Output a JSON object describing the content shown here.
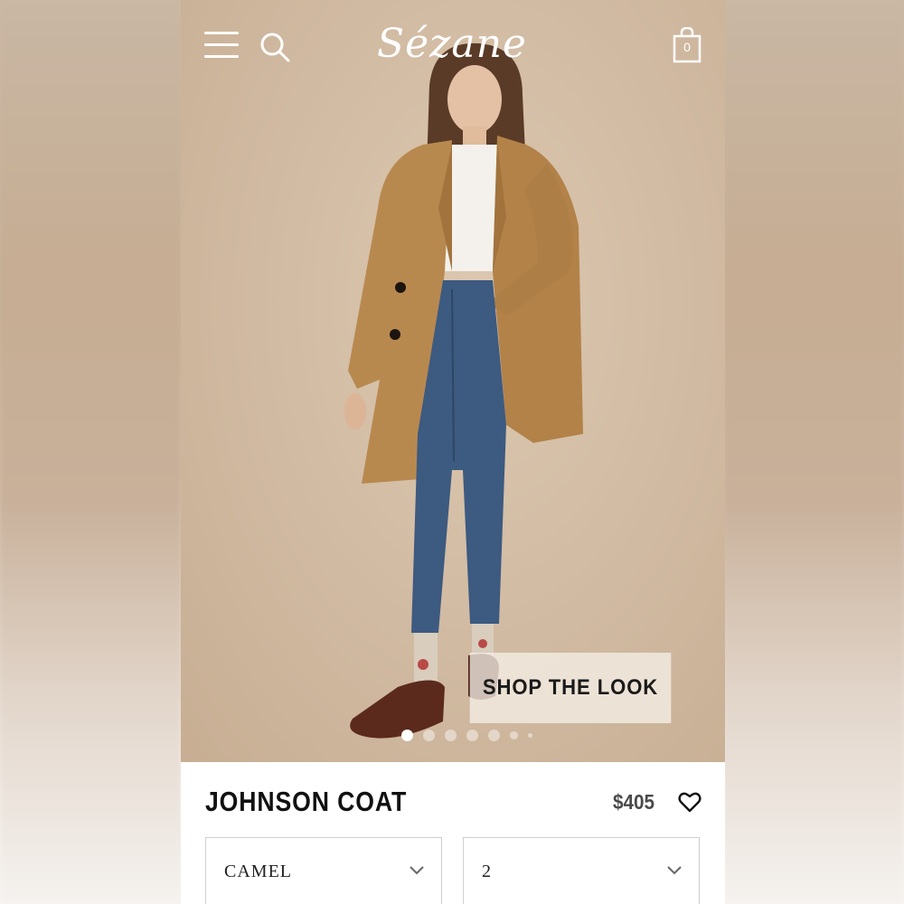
{
  "header": {
    "brand": "Sézane",
    "cart_count": "0"
  },
  "hero": {
    "shop_the_look_label": "SHOP THE LOOK",
    "carousel_dots": 7,
    "active_dot": 1
  },
  "product": {
    "name": "JOHNSON COAT",
    "price": "$405",
    "color_select": {
      "value": "CAMEL"
    },
    "size_select": {
      "value": "2"
    }
  },
  "colors": {
    "coat": "#b8894f",
    "jeans": "#3d5a80",
    "background": "#d2bca4"
  }
}
